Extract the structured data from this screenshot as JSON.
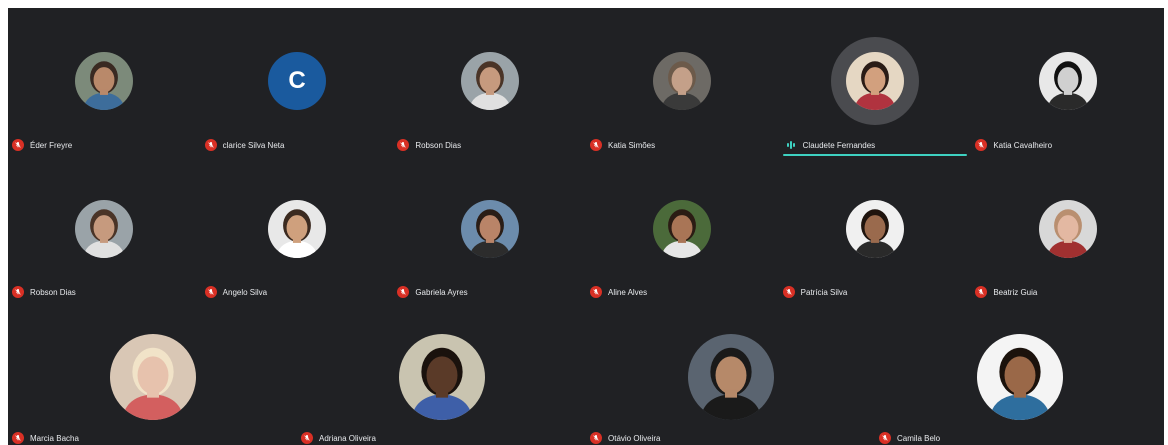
{
  "participants": [
    {
      "name": "Éder Freyre",
      "muted": true,
      "skin": "#b9896a",
      "bg": "#7c8a7a",
      "shirt": "#3d6d9b",
      "hair": "#3a2a22"
    },
    {
      "name": "clarice Silva Neta",
      "muted": true,
      "initial": "C",
      "bg": "#1a5a9e"
    },
    {
      "name": "Robson Dias",
      "muted": true,
      "skin": "#c69a7e",
      "bg": "#9aa3a8",
      "shirt": "#e0e0e0",
      "hair": "#4a3427"
    },
    {
      "name": "Katia Simões",
      "muted": true,
      "skin": "#c4a089",
      "bg": "#6d6a65",
      "shirt": "#3a3a3a",
      "hair": "#6c5a4a"
    },
    {
      "name": "Claudete Fernandes",
      "muted": false,
      "speaking": true,
      "skin": "#d2a07e",
      "bg": "#e5d7c3",
      "shirt": "#b0333f",
      "hair": "#2a1c16"
    },
    {
      "name": "Katia Cavalheiro",
      "muted": true,
      "skin": "#d0d0d0",
      "bg": "#e8e8e8",
      "shirt": "#2a2a2a",
      "hair": "#111111"
    },
    {
      "name": "Robson Dias",
      "muted": true,
      "skin": "#c69a7e",
      "bg": "#9aa3a8",
      "shirt": "#e0e0e0",
      "hair": "#4a3427"
    },
    {
      "name": "Angelo Silva",
      "muted": true,
      "skin": "#cfa07d",
      "bg": "#e8e8e8",
      "shirt": "#ffffff",
      "hair": "#3b2a20"
    },
    {
      "name": "Gabriela Ayres",
      "muted": true,
      "skin": "#b98468",
      "bg": "#6c8cac",
      "shirt": "#2c2c2c",
      "hair": "#2a1d16"
    },
    {
      "name": "Aline Alves",
      "muted": true,
      "skin": "#a97556",
      "bg": "#4b6a3a",
      "shirt": "#e6e6e6",
      "hair": "#2b1c14"
    },
    {
      "name": "Patrícia Silva",
      "muted": true,
      "skin": "#9a6a4d",
      "bg": "#f0f0f0",
      "shirt": "#2a2a2a",
      "hair": "#1f140e"
    },
    {
      "name": "Beatriz Guia",
      "muted": true,
      "skin": "#e3b8a2",
      "bg": "#d8d8d8",
      "shirt": "#a03030",
      "hair": "#b98f70"
    },
    {
      "name": "Marcia Bacha",
      "muted": true,
      "skin": "#e7c2ad",
      "bg": "#d9c7b5",
      "shirt": "#d35f5f",
      "hair": "#f1e3c8"
    },
    {
      "name": "Adriana Oliveira",
      "muted": true,
      "skin": "#5a3a28",
      "bg": "#c9c4b0",
      "shirt": "#3e5fa8",
      "hair": "#1a120d"
    },
    {
      "name": "Otávio Oliveira",
      "muted": true,
      "skin": "#b68969",
      "bg": "#5a6470",
      "shirt": "#1a1a1a",
      "hair": "#1a1a1a"
    },
    {
      "name": "Camila Belo",
      "muted": true,
      "skin": "#9a6848",
      "bg": "#f4f4f4",
      "shirt": "#2e6e9e",
      "hair": "#1b120c"
    }
  ]
}
